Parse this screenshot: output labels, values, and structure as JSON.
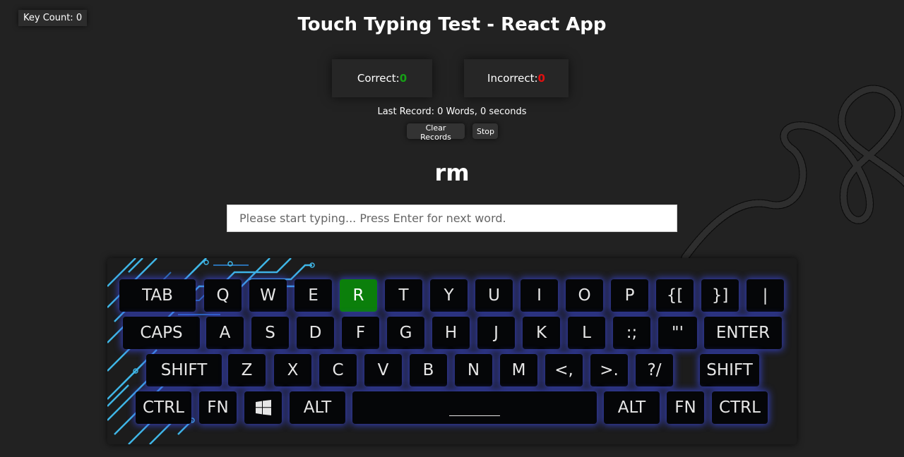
{
  "key_count": {
    "label": "Key Count:",
    "value": "0"
  },
  "title": "Touch Typing Test - React App",
  "stats": {
    "correct_label": "Correct:",
    "correct_value": "0",
    "incorrect_label": "Incorrect:",
    "incorrect_value": "0"
  },
  "last_record": "Last Record: 0 Words, 0 seconds",
  "buttons": {
    "clear": "Clear Records",
    "stop": "Stop"
  },
  "current_word": "rm",
  "input": {
    "placeholder": "Please start typing... Press Enter for next word.",
    "value": ""
  },
  "colors": {
    "background": "#222222",
    "active_key": "#0b7f0b",
    "key_glow": "#3c4be6",
    "correct": "#16a016",
    "incorrect": "#e01010"
  },
  "keyboard": {
    "active_key": "R",
    "row1": [
      "TAB",
      "Q",
      "W",
      "E",
      "R",
      "T",
      "Y",
      "U",
      "I",
      "O",
      "P",
      "{[",
      "}]",
      "|"
    ],
    "row2": [
      "CAPS",
      "A",
      "S",
      "D",
      "F",
      "G",
      "H",
      "J",
      "K",
      "L",
      ":;",
      "\"'",
      "ENTER"
    ],
    "row3": [
      "SHIFT",
      "Z",
      "X",
      "C",
      "V",
      "B",
      "N",
      "M",
      "<,",
      ">.",
      "?/",
      "SHIFT"
    ],
    "row4": [
      "CTRL",
      "FN",
      "windows-icon",
      "ALT",
      "space",
      "ALT",
      "FN",
      "CTRL"
    ]
  }
}
